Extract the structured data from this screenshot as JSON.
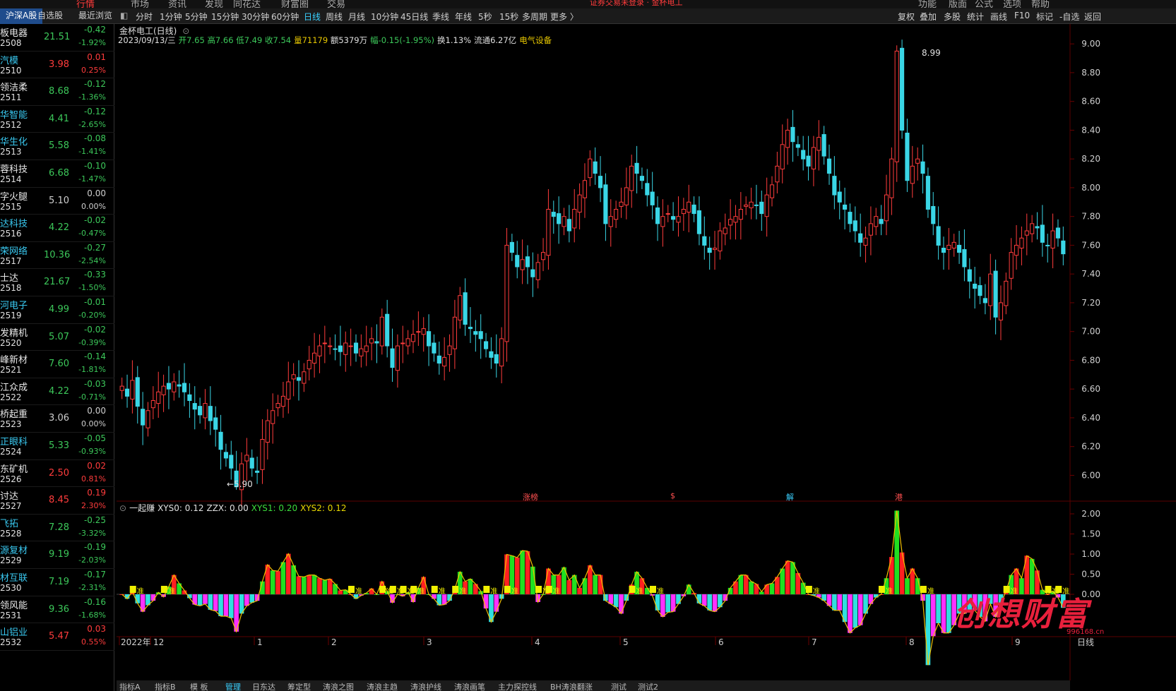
{
  "top_menu": [
    "行情",
    "市场",
    "资讯",
    "发现",
    "同花达",
    "财富圈",
    "交易",
    "证券交易未登录 · 金杯电工",
    "功能",
    "版面",
    "公式",
    "选项",
    "帮助"
  ],
  "toolbar": {
    "left_tabs": [
      "沪深A股",
      "自选股",
      "最近浏览"
    ],
    "periods": [
      "分时",
      "1分钟",
      "5分钟",
      "15分钟",
      "30分钟",
      "60分钟",
      "日线",
      "周线",
      "月线",
      "10分钟",
      "45日线",
      "季线",
      "年线",
      "5秒",
      "15秒",
      "多周期",
      "更多 〉"
    ],
    "active_period": "日线",
    "right_tools": [
      "复权",
      "叠加",
      "多股",
      "统计",
      "画线",
      "F10",
      "标记",
      "-自选",
      "返回"
    ]
  },
  "stocks": [
    {
      "name": "板电器",
      "code": "2508",
      "price": "21.51",
      "chg": "-0.42",
      "pct": "-1.92%",
      "dir": "dn",
      "cyan": false
    },
    {
      "name": "汽模",
      "code": "2510",
      "price": "3.98",
      "chg": "0.01",
      "pct": "0.25%",
      "dir": "up",
      "cyan": true
    },
    {
      "name": "领洁柔",
      "code": "2511",
      "price": "8.68",
      "chg": "-0.12",
      "pct": "-1.36%",
      "dir": "dn",
      "cyan": false
    },
    {
      "name": "华智能",
      "code": "2512",
      "price": "4.41",
      "chg": "-0.12",
      "pct": "-2.65%",
      "dir": "dn",
      "cyan": true
    },
    {
      "name": "华生化",
      "code": "2513",
      "price": "5.58",
      "chg": "-0.08",
      "pct": "-1.41%",
      "dir": "dn",
      "cyan": true
    },
    {
      "name": "蓉科技",
      "code": "2514",
      "price": "6.68",
      "chg": "-0.10",
      "pct": "-1.47%",
      "dir": "dn",
      "cyan": false
    },
    {
      "name": "字火腿",
      "code": "2515",
      "price": "5.10",
      "chg": "0.00",
      "pct": "0.00%",
      "dir": "fl",
      "cyan": false
    },
    {
      "name": "达科技",
      "code": "2516",
      "price": "4.22",
      "chg": "-0.02",
      "pct": "-0.47%",
      "dir": "dn",
      "cyan": true
    },
    {
      "name": "荣网络",
      "code": "2517",
      "price": "10.36",
      "chg": "-0.27",
      "pct": "-2.54%",
      "dir": "dn",
      "cyan": true
    },
    {
      "name": "士达",
      "code": "2518",
      "price": "21.67",
      "chg": "-0.33",
      "pct": "-1.50%",
      "dir": "dn",
      "cyan": false
    },
    {
      "name": "河电子",
      "code": "2519",
      "price": "4.99",
      "chg": "-0.01",
      "pct": "-0.20%",
      "dir": "dn",
      "cyan": true
    },
    {
      "name": "发精机",
      "code": "2520",
      "price": "5.07",
      "chg": "-0.02",
      "pct": "-0.39%",
      "dir": "dn",
      "cyan": false
    },
    {
      "name": "峰新材",
      "code": "2521",
      "price": "7.60",
      "chg": "-0.14",
      "pct": "-1.81%",
      "dir": "dn",
      "cyan": false
    },
    {
      "name": "江众成",
      "code": "2522",
      "price": "4.22",
      "chg": "-0.03",
      "pct": "-0.71%",
      "dir": "dn",
      "cyan": false
    },
    {
      "name": "桥起重",
      "code": "2523",
      "price": "3.06",
      "chg": "0.00",
      "pct": "0.00%",
      "dir": "fl",
      "cyan": false
    },
    {
      "name": "正眼科",
      "code": "2524",
      "price": "5.33",
      "chg": "-0.05",
      "pct": "-0.93%",
      "dir": "dn",
      "cyan": true
    },
    {
      "name": "东矿机",
      "code": "2526",
      "price": "2.50",
      "chg": "0.02",
      "pct": "0.81%",
      "dir": "up",
      "cyan": false
    },
    {
      "name": "讨达",
      "code": "2527",
      "price": "8.45",
      "chg": "0.19",
      "pct": "2.30%",
      "dir": "up",
      "cyan": false
    },
    {
      "name": "飞拓",
      "code": "2528",
      "price": "7.28",
      "chg": "-0.25",
      "pct": "-3.32%",
      "dir": "dn",
      "cyan": true
    },
    {
      "name": "源复材",
      "code": "2529",
      "price": "9.19",
      "chg": "-0.19",
      "pct": "-2.03%",
      "dir": "dn",
      "cyan": true
    },
    {
      "name": "材互联",
      "code": "2530",
      "price": "7.19",
      "chg": "-0.17",
      "pct": "-2.31%",
      "dir": "dn",
      "cyan": true
    },
    {
      "name": "领风能",
      "code": "2531",
      "price": "9.36",
      "chg": "-0.16",
      "pct": "-1.68%",
      "dir": "dn",
      "cyan": false
    },
    {
      "name": "山铝业",
      "code": "2532",
      "price": "5.47",
      "chg": "0.03",
      "pct": "0.55%",
      "dir": "up",
      "cyan": true
    }
  ],
  "chart_header": {
    "title": "金杯电工(日线)",
    "date": "2023/09/13/三",
    "open": "开7.65",
    "high": "高7.66",
    "low": "低7.49",
    "close": "收7.54",
    "volume": "量71179",
    "amount": "额5379万",
    "range": "幅-0.15(-1.95%)",
    "turnover": "换1.13%",
    "float": "流通6.27亿",
    "sector": "电气设备"
  },
  "price_axis": [
    "9.00",
    "8.80",
    "8.60",
    "8.40",
    "8.20",
    "8.00",
    "7.80",
    "7.60",
    "7.40",
    "7.20",
    "7.00",
    "6.80",
    "6.60",
    "6.40",
    "6.20",
    "6.00"
  ],
  "annotations": {
    "high": "8.99",
    "low": "5.90",
    "events": [
      "涨榜",
      "$",
      "解",
      "港"
    ]
  },
  "indicator": {
    "name": "一起赚",
    "xys0": "XYS0: 0.12",
    "zzx": "ZZX: 0.00",
    "xys1": "XYS1: 0.20",
    "xys2": "XYS2: 0.12",
    "axis": [
      "2.00",
      "1.50",
      "1.00",
      "0.50",
      "0.00"
    ],
    "marker": "准"
  },
  "x_axis": {
    "labels": [
      "2022年",
      "12",
      "1",
      "2",
      "3",
      "4",
      "5",
      "6",
      "7",
      "8",
      "9"
    ],
    "right": "日线"
  },
  "bottom_tabs": [
    "指标A",
    "指标B",
    "模 板",
    "管理",
    "日东达",
    "筹定型",
    "涛浪之图",
    "涛浪主趋",
    "涛浪护线",
    "涛浪画笔",
    "主力探控线",
    "BH涛浪翻涨",
    "测试",
    "测试2"
  ],
  "watermark": {
    "text": "创想财富",
    "url": "996168.cn"
  },
  "colors": {
    "up": "#ff3c3c",
    "down": "#3ad6e6",
    "accent": "#3ad0ff",
    "grid": "#2a0000"
  },
  "chart_data": {
    "type": "candlestick",
    "title": "金杯电工(日线)",
    "ylim": [
      5.85,
      9.05
    ],
    "high_label": 8.99,
    "low_label": 5.9,
    "closes": [
      6.62,
      6.55,
      6.66,
      6.48,
      6.35,
      6.45,
      6.52,
      6.58,
      6.62,
      6.6,
      6.65,
      6.62,
      6.58,
      6.52,
      6.46,
      6.42,
      6.5,
      6.38,
      6.32,
      6.18,
      6.12,
      6.05,
      5.92,
      6.08,
      6.14,
      6.05,
      6.02,
      6.25,
      6.38,
      6.45,
      6.5,
      6.55,
      6.65,
      6.7,
      6.66,
      6.72,
      6.8,
      6.85,
      6.9,
      6.92,
      6.9,
      6.88,
      6.86,
      6.92,
      6.9,
      6.85,
      6.88,
      6.9,
      6.95,
      6.92,
      7.1,
      6.9,
      6.75,
      6.9,
      6.92,
      6.95,
      6.98,
      7.0,
      7.02,
      6.9,
      6.85,
      6.78,
      6.82,
      6.9,
      7.1,
      7.25,
      7.05,
      7.02,
      6.98,
      6.95,
      6.88,
      6.82,
      6.78,
      6.95,
      7.6,
      7.55,
      7.45,
      7.5,
      7.45,
      7.38,
      7.48,
      7.55,
      7.85,
      7.8,
      7.75,
      7.8,
      7.7,
      7.85,
      7.95,
      8.05,
      8.2,
      8.1,
      8.0,
      7.75,
      7.8,
      7.85,
      7.9,
      8.0,
      8.15,
      8.1,
      8.05,
      7.95,
      7.88,
      7.75,
      7.8,
      7.82,
      7.78,
      7.8,
      7.85,
      7.9,
      7.82,
      7.68,
      7.6,
      7.55,
      7.58,
      7.7,
      7.72,
      7.78,
      7.8,
      7.85,
      7.88,
      7.9,
      7.88,
      7.82,
      7.95,
      8.02,
      8.15,
      8.3,
      8.4,
      8.32,
      8.28,
      8.2,
      8.15,
      8.28,
      8.35,
      8.22,
      8.1,
      7.95,
      7.9,
      7.85,
      7.75,
      7.7,
      7.62,
      7.65,
      7.75,
      7.8,
      7.75,
      7.95,
      8.2,
      8.95,
      8.4,
      8.05,
      8.15,
      8.2,
      8.1,
      7.85,
      7.75,
      7.6,
      7.55,
      7.6,
      7.62,
      7.55,
      7.45,
      7.35,
      7.3,
      7.25,
      7.2,
      7.4,
      7.1,
      7.2,
      7.35,
      7.55,
      7.6,
      7.65,
      7.7,
      7.75,
      7.72,
      7.62,
      7.6,
      7.7,
      7.65,
      7.54
    ],
    "x_ticks": [
      "2022年",
      "12",
      "1",
      "2",
      "3",
      "4",
      "5",
      "6",
      "7",
      "8",
      "9"
    ]
  }
}
